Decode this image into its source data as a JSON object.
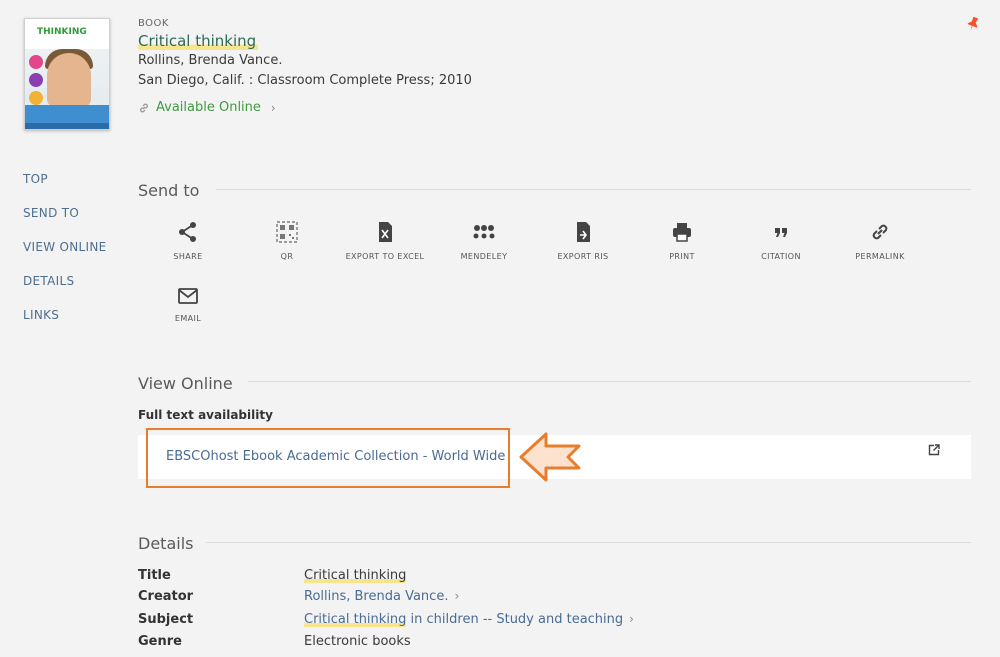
{
  "record": {
    "type": "BOOK",
    "title": "Critical thinking",
    "creator": "Rollins, Brenda Vance.",
    "publication": "San Diego, Calif. : Classroom Complete Press; 2010",
    "availability": "Available Online",
    "cover_title": "THINKING"
  },
  "leftnav": {
    "items": [
      "TOP",
      "SEND TO",
      "VIEW ONLINE",
      "DETAILS",
      "LINKS"
    ]
  },
  "send_to": {
    "heading": "Send to",
    "actions": [
      {
        "label": "SHARE",
        "icon": "share-icon"
      },
      {
        "label": "QR",
        "icon": "qr-icon"
      },
      {
        "label": "EXPORT TO EXCEL",
        "icon": "excel-icon"
      },
      {
        "label": "MENDELEY",
        "icon": "mendeley-icon"
      },
      {
        "label": "EXPORT RIS",
        "icon": "export-ris-icon"
      },
      {
        "label": "PRINT",
        "icon": "print-icon"
      },
      {
        "label": "CITATION",
        "icon": "citation-icon"
      },
      {
        "label": "PERMALINK",
        "icon": "permalink-icon"
      },
      {
        "label": "EMAIL",
        "icon": "email-icon"
      }
    ]
  },
  "view_online": {
    "heading": "View Online",
    "fulltext_label": "Full text availability",
    "link": "EBSCOhost Ebook Academic Collection - World Wide"
  },
  "details": {
    "heading": "Details",
    "rows": [
      {
        "key": "Title",
        "value": "Critical thinking"
      },
      {
        "key": "Creator",
        "value": "Rollins, Brenda Vance."
      },
      {
        "key": "Subject",
        "value_highlight": "Critical thinking",
        "value_rest": " in children -- Study and teaching"
      },
      {
        "key": "Genre",
        "value": "Electronic books"
      }
    ]
  },
  "colors": {
    "accent_link": "#4a6b92",
    "available": "#3f9a3f",
    "annotation": "#ea7d2c",
    "pin": "#f2542d"
  }
}
